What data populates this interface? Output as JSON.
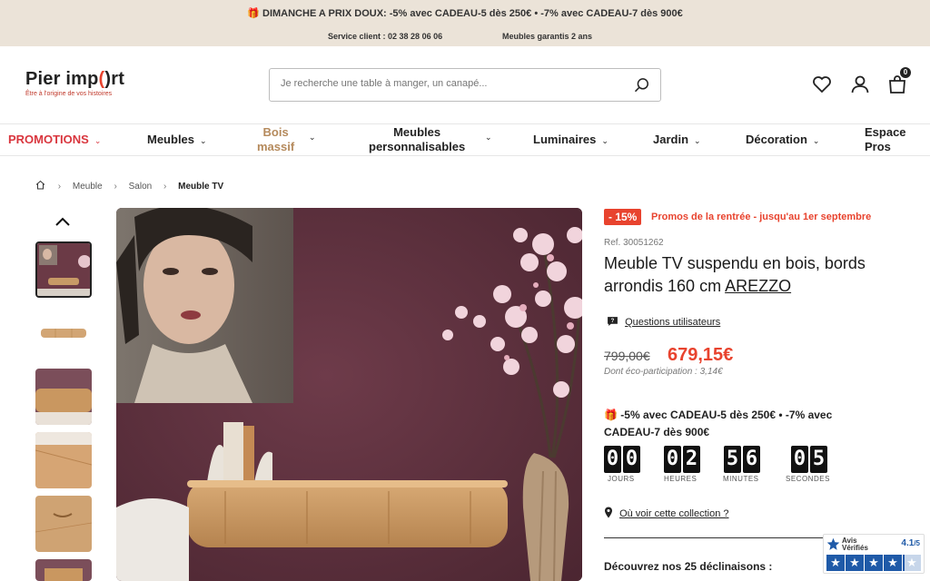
{
  "topbar": {
    "promo": "🎁 DIMANCHE A PRIX DOUX: -5% avec CADEAU-5 dès 250€ • -7% avec CADEAU-7 dès 900€",
    "service": "Service client : 02 38 28 06 06",
    "guarantee": "Meubles garantis 2 ans"
  },
  "header": {
    "logo": "Pier import",
    "logo_tagline": "Être à l'origine de vos histoires",
    "search_placeholder": "Je recherche une table à manger, un canapé...",
    "cart_count": "0"
  },
  "nav": {
    "items": [
      {
        "label": "PROMOTIONS"
      },
      {
        "label": "Meubles"
      },
      {
        "label1": "Bois",
        "label2": "massif"
      },
      {
        "label1": "Meubles",
        "label2": "personnalisables"
      },
      {
        "label": "Luminaires"
      },
      {
        "label": "Jardin"
      },
      {
        "label": "Décoration"
      },
      {
        "label1": "Espace",
        "label2": "Pros"
      }
    ]
  },
  "breadcrumb": {
    "items": [
      "Meuble",
      "Salon",
      "Meuble TV"
    ]
  },
  "product": {
    "discount_badge": "- 15%",
    "promo_text": "Promos de la rentrée - jusqu'au 1er septembre",
    "ref": "Ref. 30051262",
    "title": "Meuble TV suspendu en bois, bords arrondis 160 cm",
    "brand": "AREZZO",
    "questions": "Questions utilisateurs",
    "old_price": "799,00€",
    "new_price": "679,15€",
    "eco": "Dont éco-participation : 3,14€",
    "gift": "🎁 -5% avec CADEAU-5 dès 250€ • -7% avec CADEAU-7 dès 900€",
    "countdown": {
      "days": [
        "0",
        "0"
      ],
      "hours": [
        "0",
        "2"
      ],
      "minutes": [
        "5",
        "6"
      ],
      "seconds": [
        "0",
        "5"
      ],
      "labels": [
        "JOURS",
        "HEURES",
        "MINUTES",
        "SECONDES"
      ]
    },
    "location": "Où voir cette collection ?",
    "variants": "Découvrez nos 25 déclinaisons :"
  },
  "reviews": {
    "name_line1": "Avis",
    "name_line2": "Vérifiés",
    "score": "4.1",
    "score_suffix": "/5",
    "rating": 4.1
  }
}
